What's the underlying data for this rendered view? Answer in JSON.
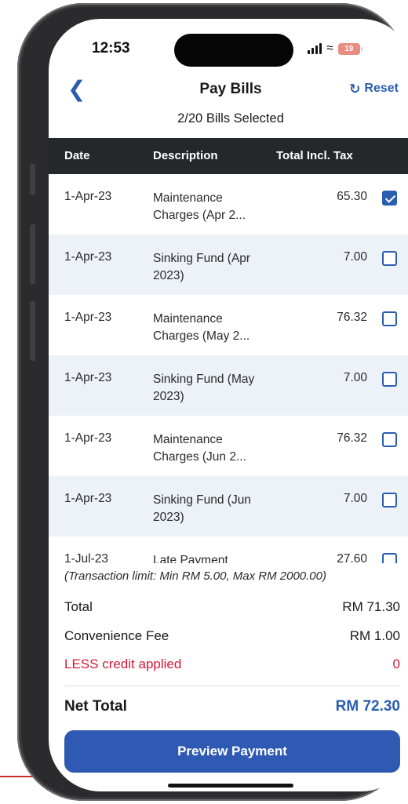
{
  "status_bar": {
    "time": "12:53",
    "battery_level": "19"
  },
  "header": {
    "title": "Pay Bills",
    "reset_label": "Reset",
    "selection_summary": "2/20 Bills Selected"
  },
  "table": {
    "columns": [
      "Date",
      "Description",
      "Total Incl. Tax"
    ],
    "rows": [
      {
        "date": "1-Apr-23",
        "description": "Maintenance Charges (Apr 2...",
        "amount": "65.30",
        "checked": true
      },
      {
        "date": "1-Apr-23",
        "description": "Sinking Fund (Apr 2023)",
        "amount": "7.00",
        "checked": false
      },
      {
        "date": "1-Apr-23",
        "description": "Maintenance Charges (May 2...",
        "amount": "76.32",
        "checked": false
      },
      {
        "date": "1-Apr-23",
        "description": "Sinking Fund (May 2023)",
        "amount": "7.00",
        "checked": false
      },
      {
        "date": "1-Apr-23",
        "description": "Maintenance Charges (Jun 2...",
        "amount": "76.32",
        "checked": false
      },
      {
        "date": "1-Apr-23",
        "description": "Sinking Fund (Jun 2023)",
        "amount": "7.00",
        "checked": false
      },
      {
        "date": "1-Jul-23",
        "description": "Late Payment",
        "amount": "27.60",
        "checked": false
      }
    ]
  },
  "summary": {
    "limit_note": "(Transaction limit: Min RM 5.00, Max RM 2000.00)",
    "total_label": "Total",
    "total_value": "RM 71.30",
    "fee_label": "Convenience Fee",
    "fee_value": "RM 1.00",
    "credit_label": "LESS credit applied",
    "credit_value": "0",
    "net_label": "Net Total",
    "net_value": "RM 72.30"
  },
  "actions": {
    "preview_label": "Preview Payment"
  },
  "colors": {
    "accent": "#2f5ab3",
    "header_bg": "#26272b",
    "alt_row": "#edf1f8",
    "credit_red": "#d6183a"
  }
}
